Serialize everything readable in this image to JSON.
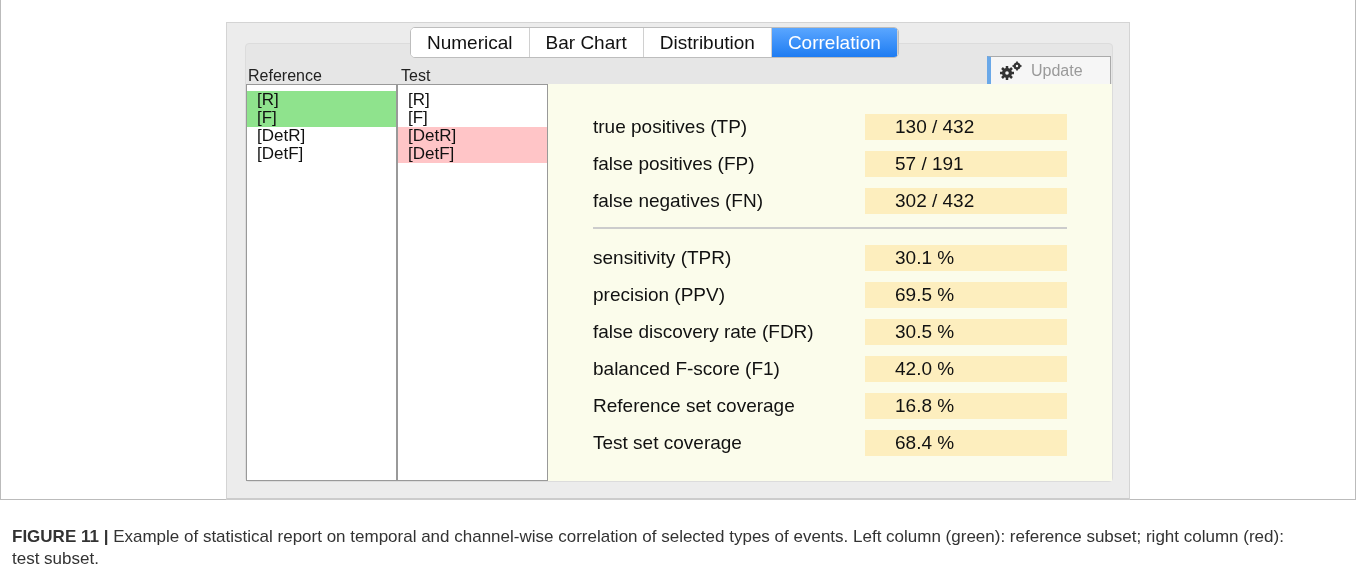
{
  "tabs": [
    {
      "label": "Numerical",
      "selected": false
    },
    {
      "label": "Bar Chart",
      "selected": false
    },
    {
      "label": "Distribution",
      "selected": false
    },
    {
      "label": "Correlation",
      "selected": true
    }
  ],
  "reference": {
    "heading": "Reference",
    "items": [
      {
        "label": "[R]",
        "selected": true
      },
      {
        "label": "[F]",
        "selected": true
      },
      {
        "label": "[DetR]",
        "selected": false
      },
      {
        "label": "[DetF]",
        "selected": false
      }
    ]
  },
  "test": {
    "heading": "Test",
    "items": [
      {
        "label": "[R]",
        "selected": false
      },
      {
        "label": "[F]",
        "selected": false
      },
      {
        "label": "[DetR]",
        "selected": true
      },
      {
        "label": "[DetF]",
        "selected": true
      }
    ]
  },
  "update_button": {
    "label": "Update",
    "disabled": true
  },
  "counts": [
    {
      "label": "true positives (TP)",
      "value": "130 / 432"
    },
    {
      "label": "false positives (FP)",
      "value": "57 / 191"
    },
    {
      "label": "false negatives (FN)",
      "value": "302 / 432"
    }
  ],
  "rates": [
    {
      "label": "sensitivity (TPR)",
      "value": "30.1 %"
    },
    {
      "label": "precision (PPV)",
      "value": "69.5 %"
    },
    {
      "label": "false discovery rate (FDR)",
      "value": "30.5 %"
    },
    {
      "label": "balanced F-score (F1)",
      "value": "42.0 %"
    },
    {
      "label": "Reference set coverage",
      "value": "16.8 %"
    },
    {
      "label": "Test set coverage",
      "value": "68.4 %"
    }
  ],
  "caption": "**FIGURE 11 |** Example of statistical report on temporal and channel-wise correlation of selected types of events. Left column (green): reference subset; right column (red): test subset."
}
